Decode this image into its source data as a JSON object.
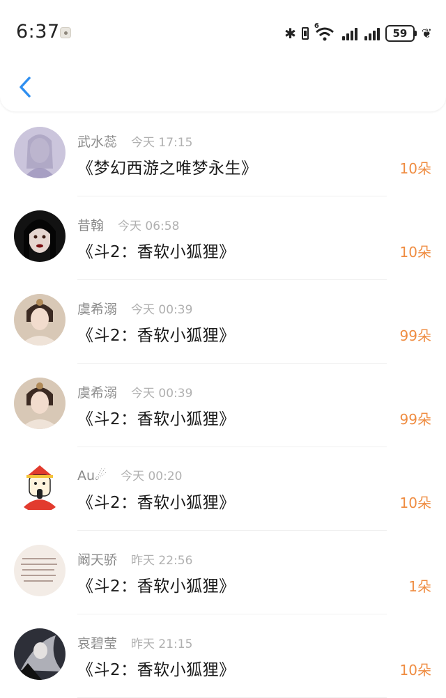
{
  "status_bar": {
    "time": "6:37",
    "network_tag": "6",
    "battery": "59"
  },
  "nav": {
    "back_icon": "chevron-left-icon",
    "accent_color": "#2f8ff0"
  },
  "gifts": [
    {
      "name": "武水蕊",
      "time": "今天 17:15",
      "title": "《梦幻西游之唯梦永生》",
      "amount": "10朵",
      "avatar_style": "ghostly"
    },
    {
      "name": "昔翰",
      "time": "今天 06:58",
      "title": "《斗2：香软小狐狸》",
      "amount": "10朵",
      "avatar_style": "gothic"
    },
    {
      "name": "虞希溺",
      "time": "今天 00:39",
      "title": "《斗2：香软小狐狸》",
      "amount": "99朵",
      "avatar_style": "costume"
    },
    {
      "name": "虞希溺",
      "time": "今天 00:39",
      "title": "《斗2：香软小狐狸》",
      "amount": "99朵",
      "avatar_style": "costume"
    },
    {
      "name": "Au☄",
      "time": "今天 00:20",
      "title": "《斗2：香软小狐狸》",
      "amount": "10朵",
      "avatar_style": "cartoon"
    },
    {
      "name": "阚天骄",
      "time": "昨天 22:56",
      "title": "《斗2：香软小狐狸》",
      "amount": "1朵",
      "avatar_style": "handwriting"
    },
    {
      "name": "哀碧莹",
      "time": "昨天 21:15",
      "title": "《斗2：香软小狐狸》",
      "amount": "10朵",
      "avatar_style": "dark"
    }
  ],
  "amount_color": "#ef8c41"
}
